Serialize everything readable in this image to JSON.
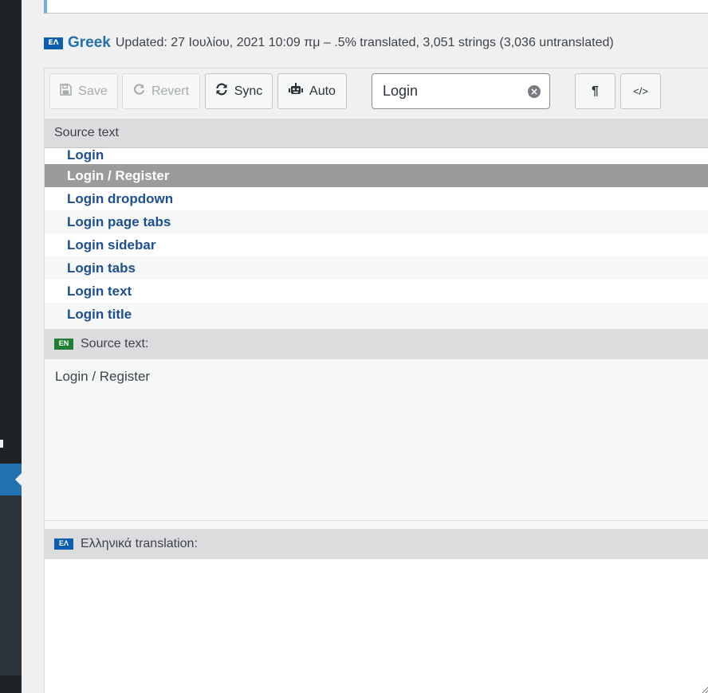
{
  "locale": {
    "flag_code": "ΕΛ",
    "name": "Greek",
    "meta": "Updated: 27 Ιουλίου, 2021 10:09 πμ – .5% translated, 3,051 strings (3,036 untranslated)"
  },
  "toolbar": {
    "save_label": "Save",
    "revert_label": "Revert",
    "sync_label": "Sync",
    "auto_label": "Auto",
    "search_value": "Login",
    "para_label": "¶",
    "code_label": "</>"
  },
  "list_header": "Source text",
  "strings": [
    "Login",
    "Login / Register",
    "Login dropdown",
    "Login page tabs",
    "Login sidebar",
    "Login tabs",
    "Login text",
    "Login title"
  ],
  "source": {
    "flag_code": "EN",
    "label": "Source text:",
    "text": "Login / Register"
  },
  "translation": {
    "flag_code": "ΕΛ",
    "label": "Ελληνικά translation:",
    "text": ""
  },
  "colors": {
    "accent": "#2271b1",
    "selected_row": "#9b9b9b",
    "string_text": "#1d4f91"
  }
}
